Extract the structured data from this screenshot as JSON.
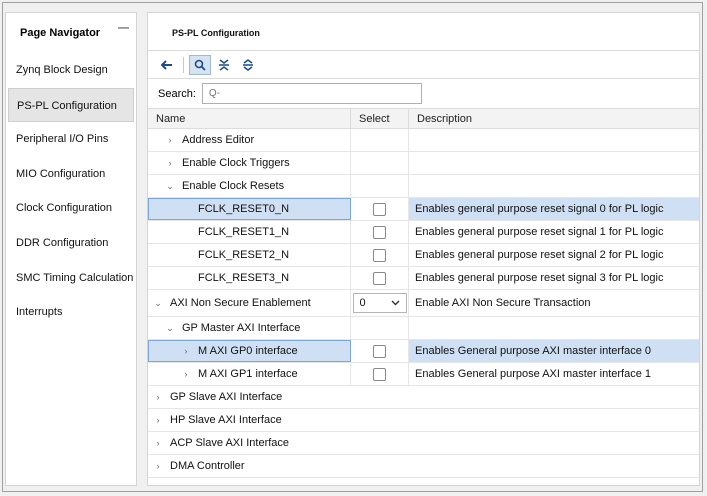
{
  "navigator": {
    "title": "Page Navigator",
    "minimize_glyph": "—",
    "items": [
      {
        "label": "Zynq Block Design"
      },
      {
        "label": "PS-PL Configuration"
      },
      {
        "label": "Peripheral I/O Pins"
      },
      {
        "label": "MIO Configuration"
      },
      {
        "label": "Clock Configuration"
      },
      {
        "label": "DDR Configuration"
      },
      {
        "label": "SMC Timing Calculation"
      },
      {
        "label": "Interrupts"
      }
    ],
    "active_index": 1
  },
  "main": {
    "title": "PS-PL Configuration",
    "toolbar": {
      "icons": [
        "back-arrow-icon",
        "search-icon",
        "collapse-all-icon",
        "expand-all-icon"
      ]
    },
    "search": {
      "label": "Search:",
      "placeholder": "Q-"
    },
    "columns": {
      "name": "Name",
      "select": "Select",
      "description": "Description"
    },
    "rows": [
      {
        "name": "Address Editor",
        "expander": "›"
      },
      {
        "name": "Enable Clock Triggers",
        "expander": "›"
      },
      {
        "name": "Enable Clock Resets",
        "expander": "⌄"
      },
      {
        "name": "FCLK_RESET0_N",
        "select": "checkbox",
        "checked": false,
        "description": "Enables general purpose reset signal 0 for PL logic",
        "selected": true
      },
      {
        "name": "FCLK_RESET1_N",
        "select": "checkbox",
        "checked": false,
        "description": "Enables general purpose reset signal 1 for PL logic"
      },
      {
        "name": "FCLK_RESET2_N",
        "select": "checkbox",
        "checked": false,
        "description": "Enables general purpose reset signal 2 for PL logic"
      },
      {
        "name": "FCLK_RESET3_N",
        "select": "checkbox",
        "checked": false,
        "description": "Enables general purpose reset signal 3 for PL logic"
      },
      {
        "name": "AXI Non Secure Enablement",
        "expander": "⌄",
        "select": "dropdown",
        "dropdown_value": "0",
        "description": "Enable AXI Non Secure Transaction"
      },
      {
        "name": "GP Master AXI Interface",
        "expander": "⌄"
      },
      {
        "name": "M AXI GP0 interface",
        "expander": "›",
        "select": "checkbox",
        "checked": false,
        "description": "Enables General purpose AXI master interface 0",
        "selected": true
      },
      {
        "name": "M AXI GP1 interface",
        "expander": "›",
        "select": "checkbox",
        "checked": false,
        "description": "Enables General purpose AXI master interface 1"
      },
      {
        "name": "GP Slave AXI Interface",
        "expander": "›"
      },
      {
        "name": "HP Slave AXI Interface",
        "expander": "›"
      },
      {
        "name": "ACP Slave AXI Interface",
        "expander": "›"
      },
      {
        "name": "DMA Controller",
        "expander": "›"
      }
    ]
  },
  "colors": {
    "selection": "#cfe0f5",
    "toolbar_icon": "#1a4d8f"
  }
}
